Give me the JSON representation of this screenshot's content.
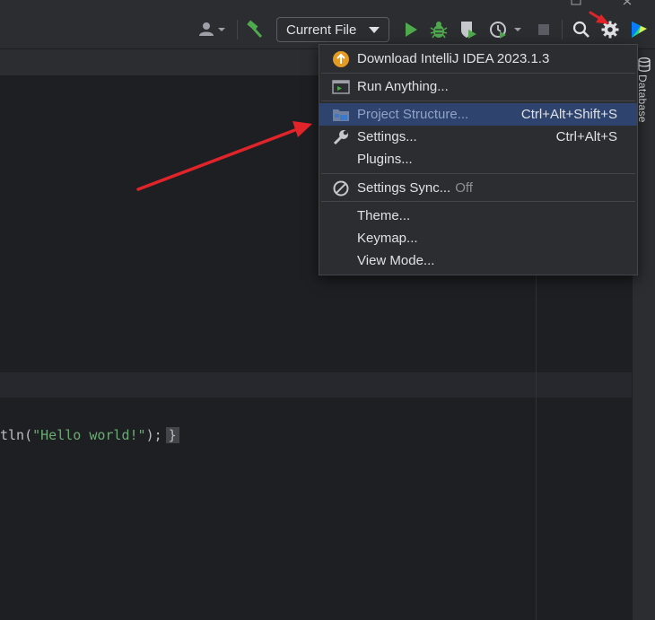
{
  "toolbar": {
    "run_config_label": "Current File",
    "colors": {
      "run": "#4fa94d",
      "debug": "#4fa94d",
      "build": "#4fa94d",
      "stop": "#5a5d63"
    }
  },
  "menu": {
    "items": [
      {
        "label": "Download IntelliJ IDEA 2023.1.3",
        "icon": "update-available-icon"
      },
      {
        "label": "Run Anything...",
        "icon": "run-anything-icon"
      },
      {
        "label": "Project Structure...",
        "shortcut": "Ctrl+Alt+Shift+S",
        "icon": "project-structure-icon",
        "selected": true
      },
      {
        "label": "Settings...",
        "shortcut": "Ctrl+Alt+S",
        "icon": "wrench-icon"
      },
      {
        "label": "Plugins..."
      },
      {
        "label": "Settings Sync...",
        "suffix": "Off",
        "icon": "sync-disabled-icon"
      },
      {
        "label": "Theme..."
      },
      {
        "label": "Keymap..."
      },
      {
        "label": "View Mode..."
      }
    ]
  },
  "editor": {
    "code_prefix": "tln(",
    "code_string": "\"Hello world!\"",
    "code_suffix": ");",
    "code_brace": "}"
  },
  "right_strip": {
    "database_label": "Database"
  },
  "annotation_color": "#e0242a"
}
